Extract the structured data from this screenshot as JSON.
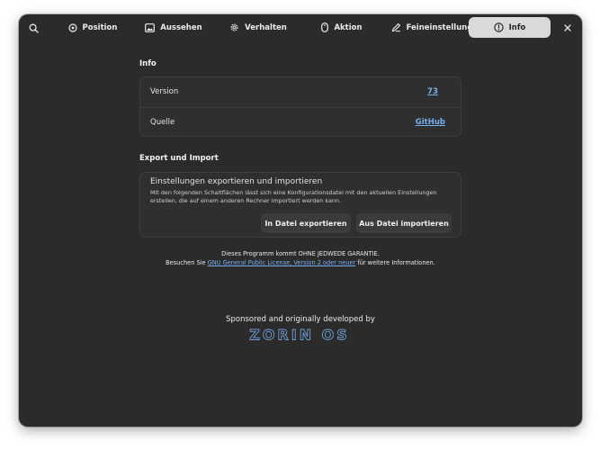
{
  "tabs": [
    {
      "label": "Position",
      "icon": "target-icon"
    },
    {
      "label": "Aussehen",
      "icon": "image-icon"
    },
    {
      "label": "Verhalten",
      "icon": "gear-icon"
    },
    {
      "label": "Aktion",
      "icon": "mouse-icon"
    },
    {
      "label": "Feineinstellung",
      "icon": "pen-icon"
    },
    {
      "label": "Info",
      "icon": "info-icon",
      "active": true
    }
  ],
  "info": {
    "title": "Info",
    "version_label": "Version",
    "version_value": "73",
    "source_label": "Quelle",
    "source_value": "GitHub"
  },
  "export": {
    "title": "Export und Import",
    "card_title": "Einstellungen exportieren und importieren",
    "card_desc": "Mit den folgenden Schaltflächen lässt sich eine Konfigurationsdatei mit den aktuellen Einstellungen erstellen, die auf einem anderen Rechner importiert werden kann.",
    "export_button": "In Datei exportieren",
    "import_button": "Aus Datei importieren"
  },
  "license": {
    "line1": "Dieses Programm kommt OHNE JEDWEDE GARANTIE.",
    "prefix": "Besuchen Sie ",
    "link": "GNU General Public License, Version 2 oder neuer",
    "suffix": " für weitere Informationen."
  },
  "sponsor": {
    "text": "Sponsored and originally developed by",
    "logo_text": "ZORIN OS"
  },
  "colors": {
    "window_bg": "#2b2b2b",
    "card_bg": "#2f2f2f",
    "link": "#78aeed",
    "active_tab": "#d9d9d9"
  }
}
